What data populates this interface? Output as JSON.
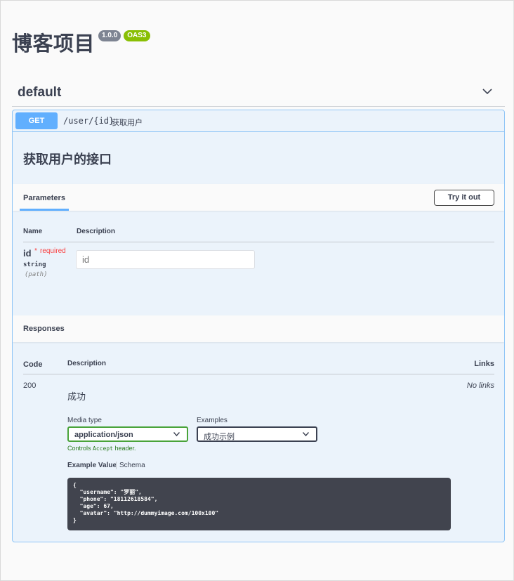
{
  "header": {
    "title": "博客项目",
    "version_badge": "1.0.0",
    "oas_badge": "OAS3"
  },
  "tag": {
    "name": "default"
  },
  "operation": {
    "method": "GET",
    "path": "/user/{id}",
    "summary": "获取用户",
    "description": "获取用户的接口",
    "parameters_tab": "Parameters",
    "try_it_out": "Try it out",
    "param_columns": {
      "name": "Name",
      "description": "Description"
    },
    "param": {
      "name": "id",
      "star": "*",
      "required": "required",
      "type": "string",
      "in": "(path)",
      "placeholder": "id"
    }
  },
  "responses": {
    "title": "Responses",
    "columns": {
      "code": "Code",
      "description": "Description",
      "links": "Links"
    },
    "row": {
      "code": "200",
      "description": "成功",
      "links": "No links",
      "media_type_label": "Media type",
      "media_type_value": "application/json",
      "examples_label": "Examples",
      "examples_value": "成功示例",
      "controls_prefix": "Controls",
      "controls_accept": "Accept",
      "controls_suffix": "header.",
      "example_value_tab": "Example Value",
      "schema_tab": "Schema",
      "example_json": "{\n  \"username\": \"罗丽\",\n  \"phone\": \"18112618584\",\n  \"age\": 67,\n  \"avatar\": \"http://dummyimage.com/100x100\"\n}"
    }
  },
  "colors": {
    "get": "#61affe",
    "required": "#f93e3e",
    "media_border": "#49a33a",
    "code_bg": "#41444e",
    "oas_badge": "#89bf04",
    "version_badge": "#7d8492"
  }
}
